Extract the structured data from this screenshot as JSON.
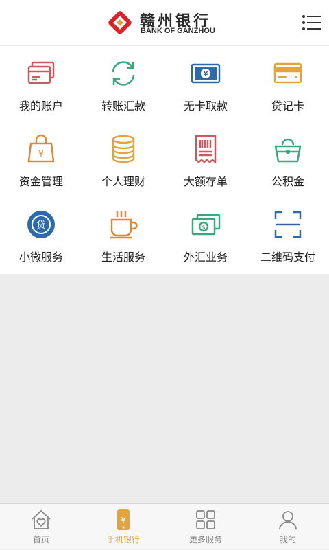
{
  "header": {
    "bank_name_cn": "赣州银行",
    "bank_name_en": "BANK OF GANZHOU",
    "menu_icon": "list-menu-icon"
  },
  "services": [
    {
      "label": "我的账户",
      "icon": "account-card-icon",
      "color": "#c95a5e"
    },
    {
      "label": "转账汇款",
      "icon": "transfer-refresh-icon",
      "color": "#3aa77e"
    },
    {
      "label": "无卡取款",
      "icon": "cardless-cash-icon",
      "color": "#2f6aa8"
    },
    {
      "label": "贷记卡",
      "icon": "credit-card-icon",
      "color": "#e2a341"
    },
    {
      "label": "资金管理",
      "icon": "money-bag-icon",
      "color": "#d98a3a"
    },
    {
      "label": "个人理财",
      "icon": "coin-stack-icon",
      "color": "#e2a341"
    },
    {
      "label": "大额存单",
      "icon": "receipt-icon",
      "color": "#c95a5e"
    },
    {
      "label": "公积金",
      "icon": "purse-icon",
      "color": "#3aa77e"
    },
    {
      "label": "小微服务",
      "icon": "loan-badge-icon",
      "color": "#2f6aa8"
    },
    {
      "label": "生活服务",
      "icon": "coffee-cup-icon",
      "color": "#d98a3a"
    },
    {
      "label": "外汇业务",
      "icon": "currency-notes-icon",
      "color": "#3aa77e"
    },
    {
      "label": "二维码支付",
      "icon": "qr-scan-icon",
      "color": "#2f6aa8"
    }
  ],
  "tabbar": [
    {
      "label": "首页",
      "icon": "home-icon",
      "active": false
    },
    {
      "label": "手机银行",
      "icon": "mobile-bank-icon",
      "active": true
    },
    {
      "label": "更多服务",
      "icon": "grid-apps-icon",
      "active": false
    },
    {
      "label": "我的",
      "icon": "user-icon",
      "active": false
    }
  ],
  "colors": {
    "brand_red": "#d8232a",
    "active_tab": "#e2a341",
    "inactive_tab": "#888888"
  }
}
